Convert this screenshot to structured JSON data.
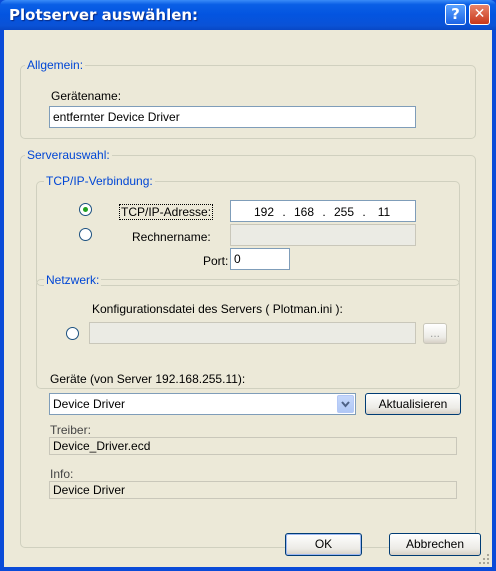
{
  "window": {
    "title": "Plotserver auswählen:",
    "help_label": "?",
    "close_label": "✕"
  },
  "allgemein": {
    "legend": "Allgemein:",
    "geraetename_label": "Gerätename:",
    "geraetename_value": "entfernter Device Driver"
  },
  "serverauswahl": {
    "legend": "Serverauswahl:",
    "tcpip": {
      "legend": "TCP/IP-Verbindung:",
      "address_label": "TCP/IP-Adresse:",
      "address_selected": true,
      "ip": [
        "192",
        "168",
        "255",
        "11"
      ],
      "rechnername_label": "Rechnername:",
      "rechnername_value": "",
      "port_label": "Port:",
      "port_value": "0"
    },
    "netzwerk": {
      "legend": "Netzwerk:",
      "config_label": "Konfigurationsdatei des Servers ( Plotman.ini ):",
      "config_value": "",
      "browse_label": "..."
    },
    "geraete_label": "Geräte (von Server 192.168.255.11):",
    "geraete_selected": "Device Driver",
    "aktualisieren_label": "Aktualisieren",
    "treiber_label": "Treiber:",
    "treiber_value": "Device_Driver.ecd",
    "info_label": "Info:",
    "info_value": "Device Driver"
  },
  "footer": {
    "ok_label": "OK",
    "cancel_label": "Abbrechen"
  },
  "colors": {
    "titlebar": "#0354e0",
    "dialog_bg": "#ece9d8",
    "legend_text": "#0046d5",
    "radio_selected": "#21a121"
  },
  "icons": {
    "help": "help-icon",
    "close": "close-icon",
    "dropdown": "chevron-down-icon",
    "resize": "resize-grip-icon"
  }
}
